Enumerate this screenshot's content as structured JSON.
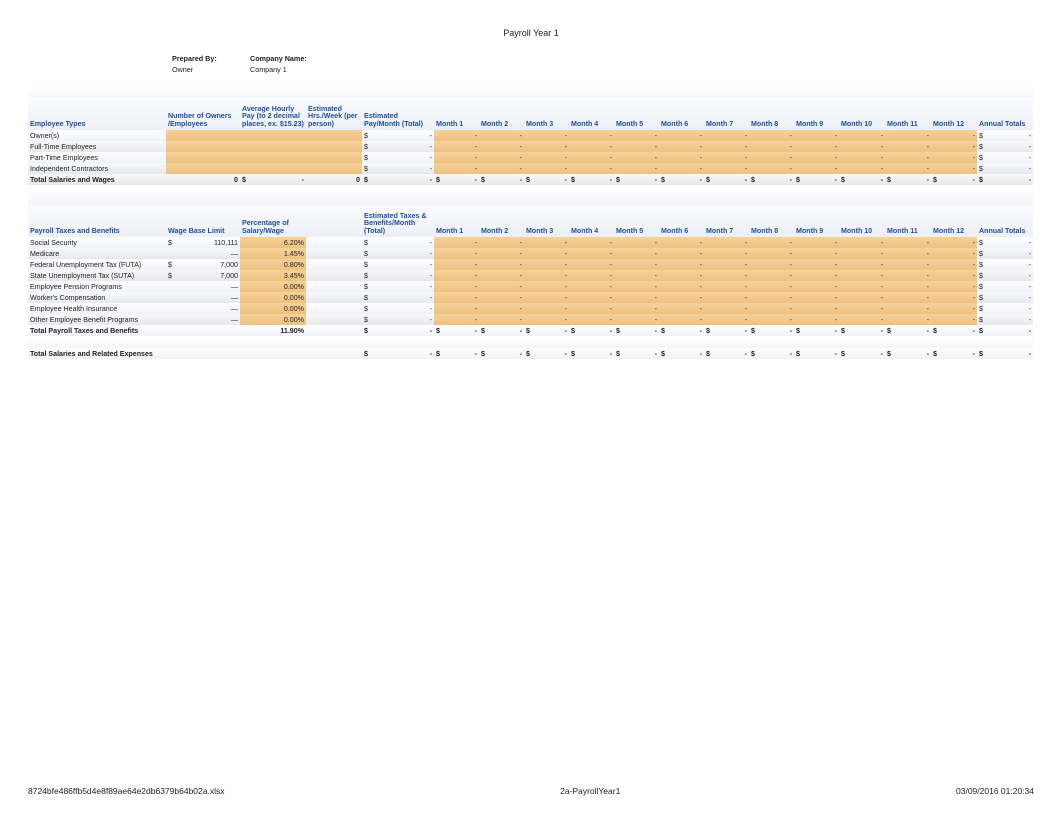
{
  "title": "Payroll Year 1",
  "meta": {
    "prepared_by_label": "Prepared By:",
    "prepared_by": "Owner",
    "company_name_label": "Company Name:",
    "company_name": "Company 1"
  },
  "headers": {
    "employee_types": "Employee Types",
    "num_owners": "Number of Owners /Employees",
    "avg_hourly": "Average Hourly Pay (to 2 decimal places, ex. $15.23)",
    "est_hrs": "Estimated Hrs./Week (per person)",
    "est_pay": "Estimated Pay/Month (Total)",
    "months": [
      "Month 1",
      "Month 2",
      "Month 3",
      "Month 4",
      "Month 5",
      "Month 6",
      "Month 7",
      "Month 8",
      "Month 9",
      "Month 10",
      "Month 11",
      "Month 12"
    ],
    "annual_totals": "Annual Totals",
    "wage_base": "Wage Base Limit",
    "pct_of_salary": "Percentage of Salary/Wage",
    "est_taxes": "Estimated Taxes & Benefits/Month (Total)",
    "payroll_taxes": "Payroll Taxes and Benefits"
  },
  "employee_rows": [
    {
      "label": "Owner(s)"
    },
    {
      "label": "Full-Time Employees"
    },
    {
      "label": "Part-Time Employees"
    },
    {
      "label": "Independent Contractors"
    }
  ],
  "total_salaries_wages": {
    "label": "Total Salaries and Wages",
    "num_owners": "0",
    "avg": "-",
    "hrs": "0"
  },
  "taxes_rows": [
    {
      "label": "Social Security",
      "wage_prefix": "$",
      "wage": "110,111",
      "pct": "6.20%"
    },
    {
      "label": "Medicare",
      "wage_prefix": "",
      "wage": "—",
      "pct": "1.45%"
    },
    {
      "label": "Federal Unemployment Tax (FUTA)",
      "wage_prefix": "$",
      "wage": "7,000",
      "pct": "0.80%"
    },
    {
      "label": "State Unemployment Tax (SUTA)",
      "wage_prefix": "$",
      "wage": "7,000",
      "pct": "3.45%"
    },
    {
      "label": "Employee Pension Programs",
      "wage_prefix": "",
      "wage": "—",
      "pct": "0.00%"
    },
    {
      "label": "Worker's Compensation",
      "wage_prefix": "",
      "wage": "—",
      "pct": "0.00%"
    },
    {
      "label": "Employee Health Insurance",
      "wage_prefix": "",
      "wage": "—",
      "pct": "0.00%"
    },
    {
      "label": "Other Employee Benefit Programs",
      "wage_prefix": "",
      "wage": "—",
      "pct": "0.00%"
    }
  ],
  "total_taxes": {
    "label": "Total Payroll Taxes and Benefits",
    "pct": "11.90%"
  },
  "grand_total": {
    "label": "Total Salaries and Related Expenses"
  },
  "dollar": "$",
  "dash": "-",
  "dash_dollar": "- $",
  "footer": {
    "left": "8724bfe486ffb5d4e8f89ae64e2db6379b64b02a.xlsx",
    "center": "2a-PayrollYear1",
    "right": "03/09/2016 01:20:34"
  }
}
